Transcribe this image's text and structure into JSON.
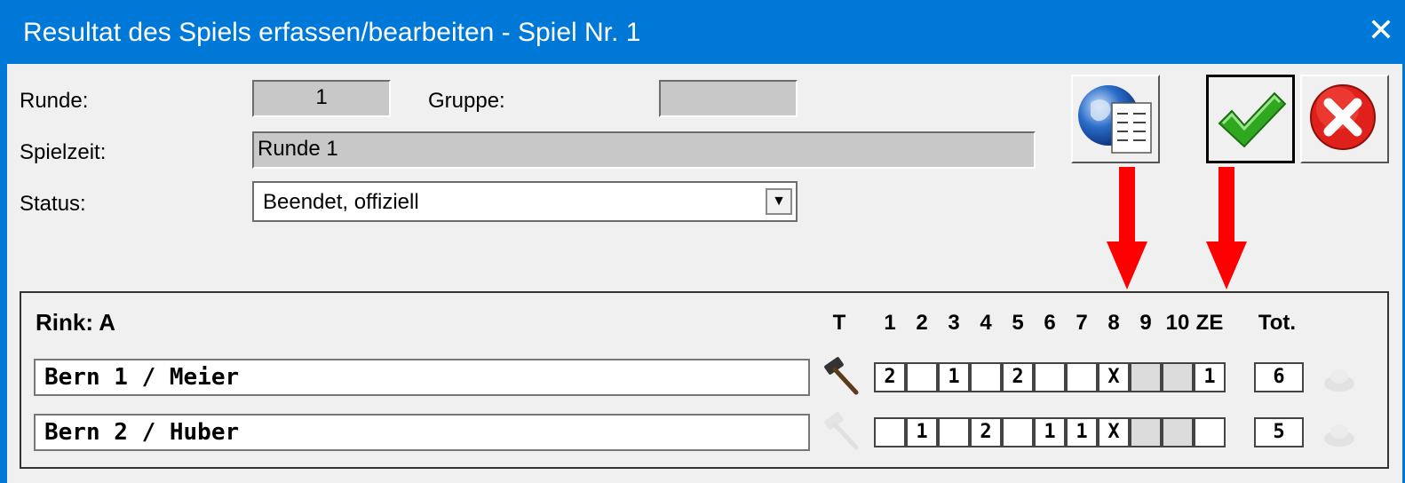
{
  "window": {
    "title": "Resultat des Spiels erfassen/bearbeiten - Spiel Nr. 1",
    "close_glyph": "✕"
  },
  "form": {
    "runde_label": "Runde:",
    "runde_value": "1",
    "gruppe_label": "Gruppe:",
    "gruppe_value": "",
    "spielzeit_label": "Spielzeit:",
    "spielzeit_value": "Runde 1",
    "status_label": "Status:",
    "status_value": "Beendet, offiziell"
  },
  "toolbar": {
    "report_icon": "globe-report-icon",
    "ok_icon": "green-checkmark-icon",
    "cancel_icon": "red-x-icon"
  },
  "colors": {
    "titlebar": "#0078d7",
    "arrow": "#ff0000",
    "check": "#2fa81f",
    "cancel": "#e0201a"
  },
  "rink": {
    "title": "Rink: A",
    "headers": [
      "T",
      "1",
      "2",
      "3",
      "4",
      "5",
      "6",
      "7",
      "8",
      "9",
      "10",
      "ZE",
      "Tot."
    ],
    "teams": [
      {
        "name": "Bern 1 / Meier",
        "hammer": true,
        "ends": [
          "2",
          "",
          "1",
          "",
          "2",
          "",
          "",
          "X",
          "",
          "",
          "1"
        ],
        "total": "6"
      },
      {
        "name": "Bern 2 / Huber",
        "hammer": false,
        "ends": [
          "",
          "1",
          "",
          "2",
          "",
          "1",
          "1",
          "X",
          "",
          "",
          ""
        ],
        "total": "5"
      }
    ]
  }
}
